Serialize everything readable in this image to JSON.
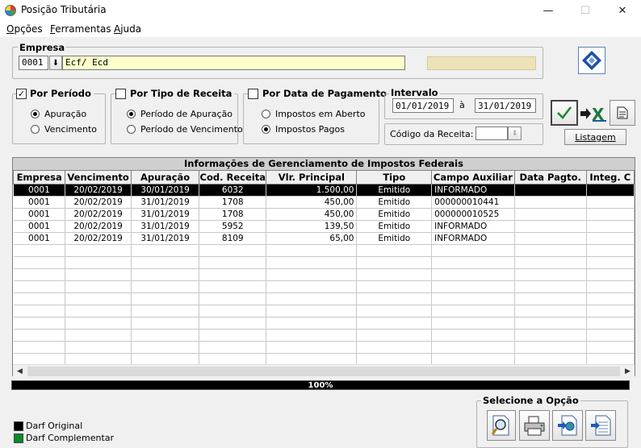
{
  "window": {
    "title": "Posição Tributária",
    "minimize": "—",
    "maximize": "☐",
    "close": "✕"
  },
  "menu": [
    {
      "first": "O",
      "rest": "pções"
    },
    {
      "first": "F",
      "rest": "erramentas"
    },
    {
      "first": "A",
      "rest": "juda"
    }
  ],
  "empresa": {
    "label": "Empresa",
    "code": "0001",
    "name": "Ecf/ Ecd",
    "download_glyph": "⬇"
  },
  "por_periodo": {
    "label": "Por Período",
    "checked": true,
    "check_glyph": "✓",
    "options": [
      "Apuração",
      "Vencimento"
    ],
    "selected": 0
  },
  "por_tipo_receita": {
    "label": "Por Tipo de Receita",
    "checked": false,
    "options": [
      "Período de Apuração",
      "Período de Vencimento"
    ],
    "selected": 0
  },
  "por_data_pagamento": {
    "label": "Por Data de Pagamento",
    "checked": false,
    "options": [
      "Impostos em Aberto",
      "Impostos Pagos"
    ],
    "selected": 1
  },
  "intervalo": {
    "label": "Intervalo",
    "from": "01/01/2019",
    "sep": "à",
    "to": "31/01/2019"
  },
  "codigo_receita": {
    "label": "Código da Receita:",
    "value": ""
  },
  "buttons": {
    "listagem": "Listagem"
  },
  "grid": {
    "caption": "Informações de Gerenciamento de Impostos Federais",
    "columns": [
      "Empresa",
      "Vencimento",
      "Apuração",
      "Cod. Receita",
      "Vlr. Principal",
      "Tipo",
      "Campo Auxiliar",
      "Data Pagto.",
      "Integ. C"
    ],
    "rows": [
      [
        "0001",
        "20/02/2019",
        "30/01/2019",
        "6032",
        "1.500,00",
        "Emitido",
        "INFORMADO",
        "",
        ""
      ],
      [
        "0001",
        "20/02/2019",
        "31/01/2019",
        "1708",
        "450,00",
        "Emitido",
        "000000010441",
        "",
        ""
      ],
      [
        "0001",
        "20/02/2019",
        "31/01/2019",
        "1708",
        "450,00",
        "Emitido",
        "000000010525",
        "",
        ""
      ],
      [
        "0001",
        "20/02/2019",
        "31/01/2019",
        "5952",
        "139,50",
        "Emitido",
        "INFORMADO",
        "",
        ""
      ],
      [
        "0001",
        "20/02/2019",
        "31/01/2019",
        "8109",
        "65,00",
        "Emitido",
        "INFORMADO",
        "",
        ""
      ]
    ],
    "selected_row": 0,
    "empty_rows": 12
  },
  "progress": {
    "text": "100%",
    "value": 100
  },
  "legend": [
    {
      "label": "Darf Original",
      "color": "#000000"
    },
    {
      "label": "Darf Complementar",
      "color": "#0a8a2a"
    }
  ],
  "selecione": {
    "label": "Selecione a Opção"
  },
  "colors": {
    "selected_row_bg": "#000000",
    "empresa_name_bg": "#ffffcc",
    "right_field_bg": "#ede2b8"
  }
}
